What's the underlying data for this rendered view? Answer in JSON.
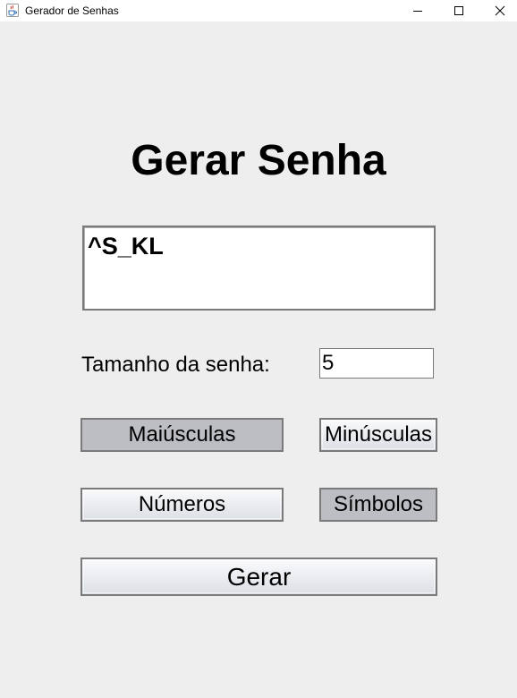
{
  "window": {
    "title": "Gerador de Senhas",
    "icon": "java-cup-icon",
    "controls": [
      "minimize-icon",
      "maximize-icon",
      "close-icon"
    ]
  },
  "main": {
    "heading": "Gerar Senha",
    "password_output": "^S_KL",
    "size_label": "Tamanho da senha:",
    "size_value": "5"
  },
  "options": {
    "uppercase": {
      "label": "Maiúsculas",
      "selected": true
    },
    "lowercase": {
      "label": "Minúsculas",
      "selected": false
    },
    "numbers": {
      "label": "Números",
      "selected": false
    },
    "symbols": {
      "label": "Símbolos",
      "selected": true
    }
  },
  "actions": {
    "generate_label": "Gerar"
  },
  "colors": {
    "background": "#eeeeee",
    "selected_button": "#bcbec4",
    "border": "#7a7a7a"
  }
}
